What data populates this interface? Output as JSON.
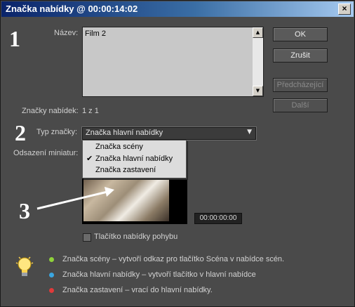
{
  "window": {
    "title": "Značka nabídky @ 00:00:14:02",
    "close_glyph": "×"
  },
  "annotations": {
    "n1": "1",
    "n2": "2",
    "n3": "3"
  },
  "fields": {
    "nazev_label": "Název:",
    "nazev_value": "Film 2",
    "znacky_label": "Značky nabídek:",
    "znacky_value": "1 z 1",
    "typ_label": "Typ značky:",
    "typ_value": "Značka hlavní nabídky",
    "odsazeni_label": "Odsazení miniatur:"
  },
  "buttons": {
    "ok": "OK",
    "zrusit": "Zrušit",
    "predchazejici": "Předcházející",
    "dalsi": "Další"
  },
  "dropdown": {
    "items": [
      {
        "label": "Značka scény",
        "checked": false
      },
      {
        "label": "Značka hlavní nabídky",
        "checked": true
      },
      {
        "label": "Značka zastavení",
        "checked": false
      }
    ],
    "check_glyph": "✔"
  },
  "video": {
    "timecode": "00:00:00:00"
  },
  "checkbox": {
    "label": "Tlačítko nabídky pohybu",
    "checked": false
  },
  "legend": [
    {
      "text": "Značka scény – vytvoří odkaz pro tlačítko Scéna v nabídce scén.",
      "color": "#8fd23a"
    },
    {
      "text": "Značka hlavní nabídky – vytvoří tlačítko v hlavní nabídce",
      "color": "#3aa6e0"
    },
    {
      "text": "Značka zastavení – vrací do hlavní nabídky.",
      "color": "#e03a3a"
    }
  ],
  "icons": {
    "tip": "lightbulb-icon",
    "arrow": "annotation-arrow-icon"
  }
}
